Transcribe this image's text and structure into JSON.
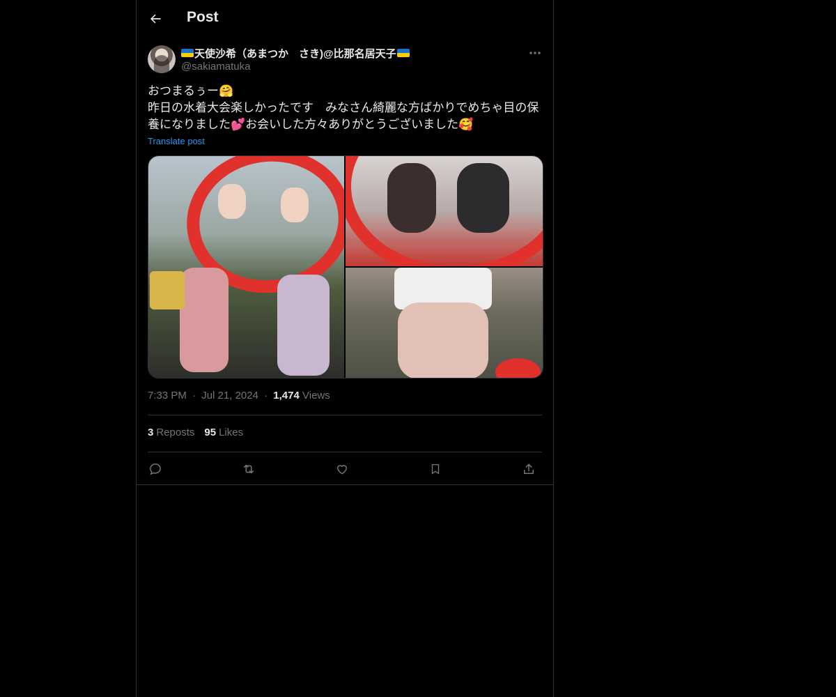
{
  "header": {
    "title": "Post",
    "back_icon": "arrow-left-icon"
  },
  "author": {
    "display_name": "天使沙希（あまつか　さき)@比那名居天子",
    "handle": "@sakiamatuka",
    "flag_icon": "ukraine-flag-icon"
  },
  "post": {
    "lines": [
      "おつまるぅー🤗",
      "昨日の水着大会楽しかったです　みなさん綺麗な方ばかりでめちゃ目の保養になりました💕お会いした方々ありがとうございました🥰"
    ],
    "translate_label": "Translate post",
    "time": "7:33 PM",
    "date": "Jul 21, 2024",
    "views_count": "1,474",
    "views_label": "Views",
    "separator": "·"
  },
  "stats": {
    "reposts_count": "3",
    "reposts_label": "Reposts",
    "likes_count": "95",
    "likes_label": "Likes"
  },
  "actions": [
    "reply-icon",
    "repost-icon",
    "like-icon",
    "bookmark-icon",
    "share-icon"
  ],
  "colors": {
    "background": "#000000",
    "text": "#e7e9ea",
    "secondary_text": "#71767b",
    "link": "#1d9bf0",
    "divider": "#2f3336"
  }
}
